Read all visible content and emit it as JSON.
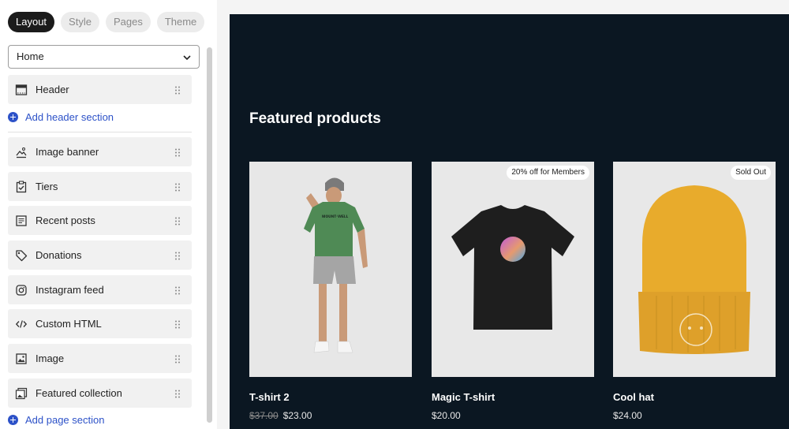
{
  "tabs": [
    {
      "label": "Layout"
    },
    {
      "label": "Style"
    },
    {
      "label": "Pages"
    },
    {
      "label": "Theme"
    }
  ],
  "page_select": {
    "value": "Home"
  },
  "sections": {
    "header": {
      "label": "Header",
      "icon": "header-layout-icon"
    },
    "add_header": "Add header section",
    "items": [
      {
        "label": "Image banner",
        "icon": "image-banner-icon"
      },
      {
        "label": "Tiers",
        "icon": "clipboard-check-icon"
      },
      {
        "label": "Recent posts",
        "icon": "document-lines-icon"
      },
      {
        "label": "Donations",
        "icon": "tag-icon"
      },
      {
        "label": "Instagram feed",
        "icon": "instagram-icon"
      },
      {
        "label": "Custom HTML",
        "icon": "code-icon"
      },
      {
        "label": "Image",
        "icon": "image-icon"
      },
      {
        "label": "Featured collection",
        "icon": "featured-collection-icon"
      }
    ],
    "add_page": "Add page section"
  },
  "preview": {
    "heading": "Featured products",
    "products": [
      {
        "name": "T-shirt 2",
        "old_price": "$37.00",
        "price": "$23.00",
        "badge": ""
      },
      {
        "name": "Magic T-shirt",
        "old_price": "",
        "price": "$20.00",
        "badge": "20% off for Members"
      },
      {
        "name": "Cool hat",
        "old_price": "",
        "price": "$24.00",
        "badge": "Sold Out"
      }
    ]
  },
  "colors": {
    "accent": "#2d52c8",
    "preview_bg": "#0b1722",
    "active_tab": "#1b1b1b"
  }
}
